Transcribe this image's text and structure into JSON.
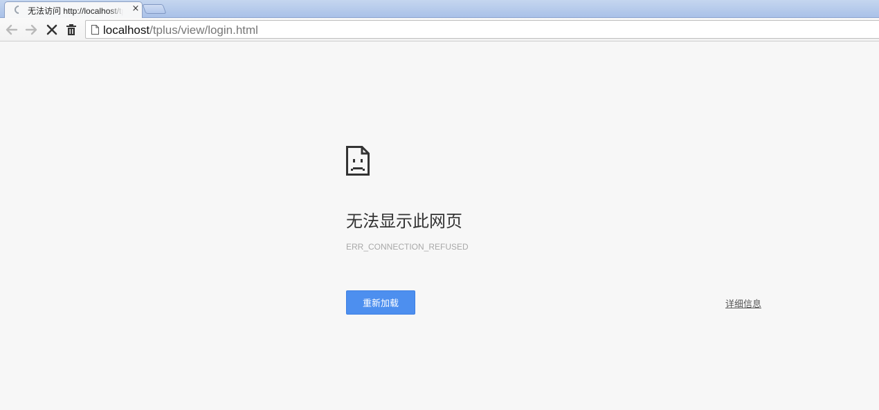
{
  "tab": {
    "title": "无法访问 http://localhost/tplus/view/login.html",
    "close_glyph": "×"
  },
  "toolbar": {
    "back_icon": "back-arrow-icon",
    "forward_icon": "forward-arrow-icon",
    "stop_icon": "stop-x-icon",
    "trash_icon": "trash-icon"
  },
  "omnibox": {
    "host": "localhost",
    "path": "/tplus/view/login.html"
  },
  "error": {
    "title": "无法显示此网页",
    "code": "ERR_CONNECTION_REFUSED",
    "reload_label": "重新加载",
    "details_label": "详细信息"
  },
  "colors": {
    "accent_button": "#4d8fef",
    "page_background": "#f7f7f7",
    "tabstrip": "#a9c1e8"
  }
}
